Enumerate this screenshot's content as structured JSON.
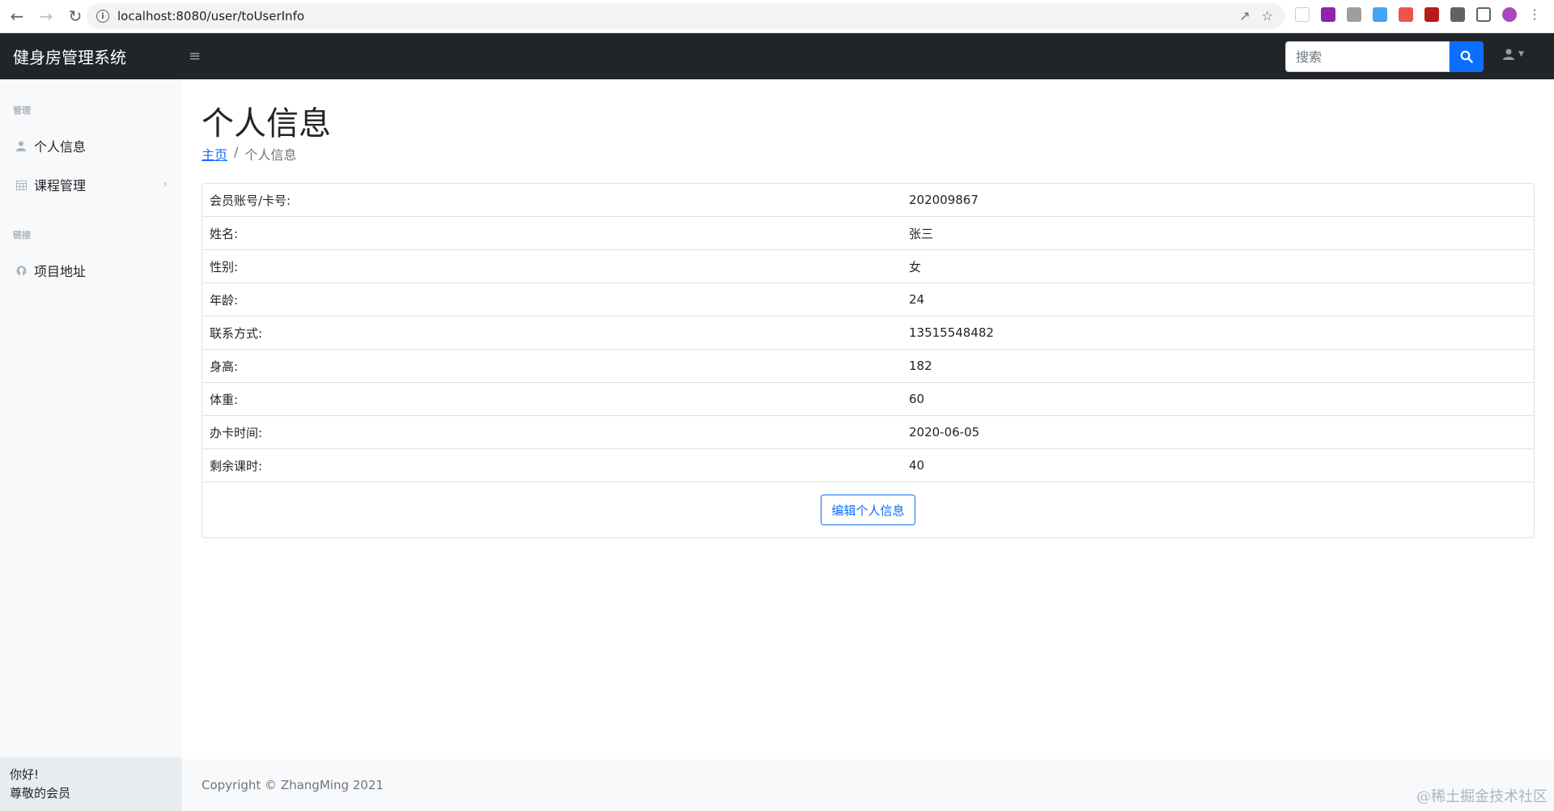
{
  "browser": {
    "url": "localhost:8080/user/toUserInfo"
  },
  "navbar": {
    "brand": "健身房管理系统",
    "search_placeholder": "搜索"
  },
  "sidebar": {
    "heading_manage": "管理",
    "heading_links": "链接",
    "items": [
      {
        "label": "个人信息"
      },
      {
        "label": "课程管理"
      },
      {
        "label": "项目地址"
      }
    ],
    "footer_greeting": "你好!",
    "footer_user": "尊敬的会员"
  },
  "main": {
    "title": "个人信息",
    "breadcrumb_home": "主页",
    "breadcrumb_sep": "/",
    "breadcrumb_current": "个人信息",
    "rows": [
      {
        "label": "会员账号/卡号:",
        "value": "202009867"
      },
      {
        "label": "姓名:",
        "value": "张三"
      },
      {
        "label": "性别:",
        "value": "女"
      },
      {
        "label": "年龄:",
        "value": "24"
      },
      {
        "label": "联系方式:",
        "value": "13515548482"
      },
      {
        "label": "身高:",
        "value": "182"
      },
      {
        "label": "体重:",
        "value": "60"
      },
      {
        "label": "办卡时间:",
        "value": "2020-06-05"
      },
      {
        "label": "剩余课时:",
        "value": "40"
      }
    ],
    "edit_button": "编辑个人信息"
  },
  "footer": {
    "copyright": "Copyright © ZhangMing 2021"
  },
  "watermark": "@稀土掘金技术社区",
  "colors": {
    "navbar_bg": "#212529",
    "primary": "#0d6efd",
    "sidebar_bg": "#f8f9fa"
  }
}
